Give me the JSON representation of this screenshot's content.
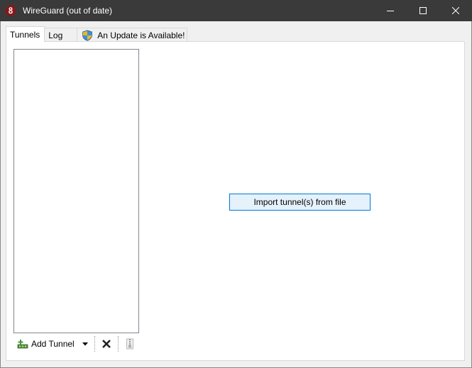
{
  "window": {
    "title": "WireGuard (out of date)",
    "titlebar_color": "#3a3a3a",
    "controls": [
      "minimize-icon",
      "maximize-icon",
      "close-icon"
    ]
  },
  "tabs": [
    {
      "label": "Tunnels",
      "active": true
    },
    {
      "label": "Log",
      "active": false
    },
    {
      "label": "An Update is Available!",
      "active": false,
      "icon": "shield-icon"
    }
  ],
  "main": {
    "import_button_label": "Import tunnel(s) from file",
    "accent": "#0078d7"
  },
  "toolbar": {
    "add_tunnel_label": "Add Tunnel",
    "icons": [
      "add-tunnel-icon",
      "chevron-down-icon",
      "delete-icon",
      "export-icon"
    ]
  }
}
